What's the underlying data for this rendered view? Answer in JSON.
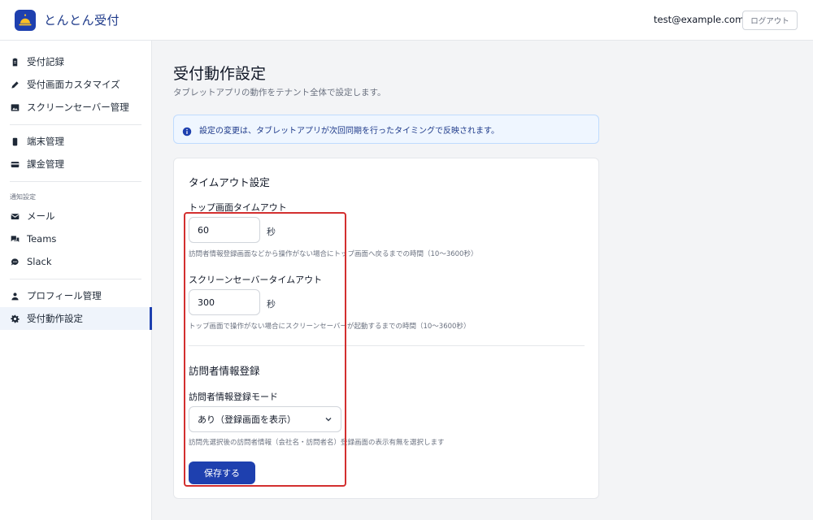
{
  "app": {
    "title": "とんとん受付",
    "icon": "bell-icon",
    "brand_color": "#1e40af"
  },
  "header": {
    "user_email": "test@example.com",
    "logout_label": "ログアウト"
  },
  "sidebar": {
    "items": [
      {
        "label": "受付記録",
        "icon": "clipboard-icon"
      },
      {
        "label": "受付画面カスタマイズ",
        "icon": "pencil-icon"
      },
      {
        "label": "スクリーンセーバー管理",
        "icon": "image-icon"
      },
      {
        "label": "端末管理",
        "icon": "tablet-icon"
      },
      {
        "label": "課金管理",
        "icon": "credit-card-icon"
      },
      {
        "label": "メール",
        "icon": "mail-icon"
      },
      {
        "label": "Teams",
        "icon": "teams-icon"
      },
      {
        "label": "Slack",
        "icon": "chat-icon"
      },
      {
        "label": "プロフィール管理",
        "icon": "user-icon"
      },
      {
        "label": "受付動作設定",
        "icon": "gear-icon",
        "active": true
      }
    ],
    "section_notifications": "通知設定"
  },
  "main": {
    "title": "受付動作設定",
    "subtitle": "タブレットアプリの動作をテナント全体で設定します。",
    "info": "設定の変更は、タブレットアプリが次回同期を行ったタイミングで反映されます。",
    "timeout_section": {
      "heading": "タイムアウト設定",
      "top_label": "トップ画面タイムアウト",
      "top_value": "60",
      "top_unit": "秒",
      "top_help": "訪問者情報登録画面などから操作がない場合にトップ画面へ戻るまでの時間（10〜3600秒）",
      "ss_label": "スクリーンセーバータイムアウト",
      "ss_value": "300",
      "ss_unit": "秒",
      "ss_help": "トップ画面で操作がない場合にスクリーンセーバーが起動するまでの時間（10〜3600秒）"
    },
    "visitor_section": {
      "heading": "訪問者情報登録",
      "mode_label": "訪問者情報登録モード",
      "mode_value": "あり（登録画面を表示）",
      "mode_help": "訪問先選択後の訪問者情報（会社名・訪問者名）登録画面の表示有無を選択します"
    },
    "save_label": "保存する"
  }
}
